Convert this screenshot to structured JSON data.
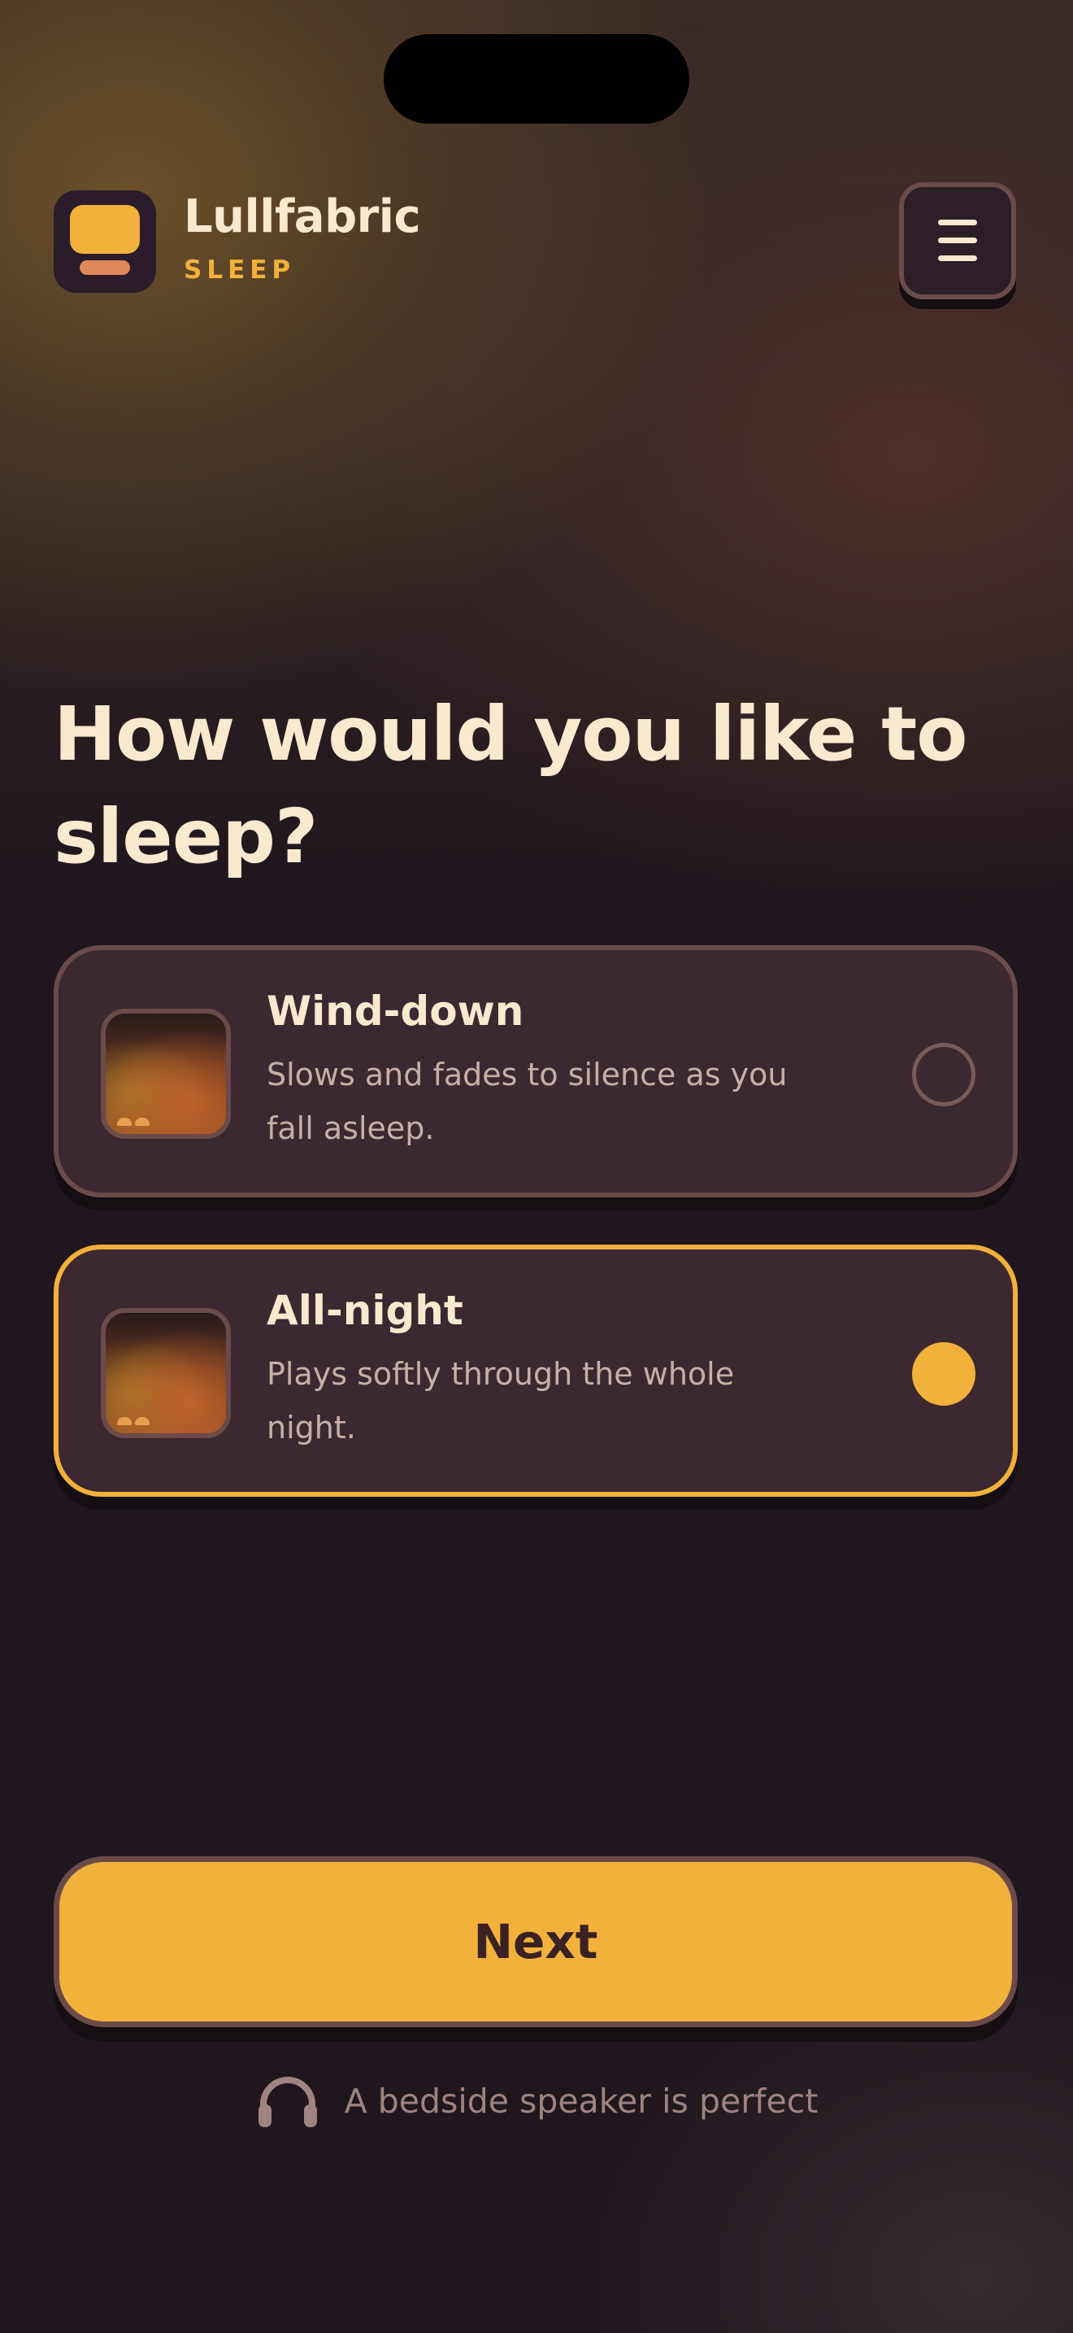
{
  "brand": {
    "name": "Lullfabric",
    "tagline": "SLEEP"
  },
  "heading": "How would you like to sleep?",
  "options": [
    {
      "title": "Wind-down",
      "description": "Slows and fades to silence as you fall asleep.",
      "selected": false
    },
    {
      "title": "All-night",
      "description": "Plays softly through the whole night.",
      "selected": true
    }
  ],
  "next_button": {
    "label": "Next"
  },
  "hint": {
    "text": "A bedside speaker is perfect",
    "icon": "headphones-icon"
  },
  "colors": {
    "accent": "#f2b13a",
    "background": "#1f171d",
    "card": "#3b2830",
    "border": "#6b4b4a",
    "text": "#fbe9cf"
  }
}
